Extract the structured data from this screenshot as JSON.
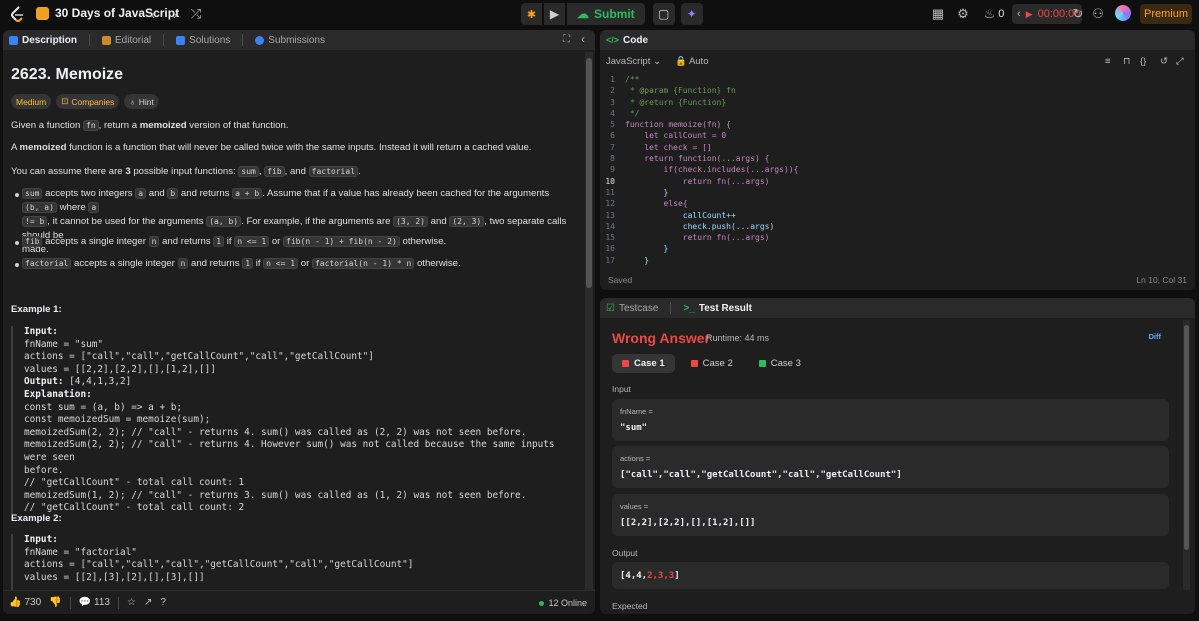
{
  "topbar": {
    "list_title": "30 Days of JavaScript",
    "submit_label": "Submit",
    "streak": "0",
    "timer": "00:00:00",
    "premium_label": "Premium"
  },
  "left": {
    "tabs": [
      "Description",
      "Editorial",
      "Solutions",
      "Submissions"
    ],
    "title": "2623. Memoize",
    "pills": [
      "Medium",
      "Companies",
      "Hint"
    ],
    "p1_a": "Given a function ",
    "p1_code": "fn",
    "p1_b": ", return a ",
    "p1_bold": "memoized",
    "p1_c": " version of that function.",
    "p2_a": "A ",
    "p2_bold": "memoized",
    "p2_b": " function is a function that will never be called twice with the same inputs. Instead it will return a cached value.",
    "p3_a": "You can assume there are ",
    "p3_bold": "3",
    "p3_b": " possible input functions: ",
    "p3_c1": "sum",
    "p3_c2": "fib",
    "p3_c3": "factorial",
    "p3_and": ", and ",
    "bullet1": {
      "c1": "sum",
      "t1": " accepts two integers ",
      "c2": "a",
      "t2": " and ",
      "c3": "b",
      "t3": " and returns ",
      "c4": "a + b",
      "t4": ". Assume that if a value has already been cached for the arguments ",
      "c5": "(b, a)",
      "t5": " where ",
      "c6": "a",
      "c7": "!= b",
      "t6": ", it cannot be used for the arguments ",
      "c8": "(a, b)",
      "t7": ". For example, if the arguments are ",
      "c9": "(3, 2)",
      "t8": " and ",
      "c10": "(2, 3)",
      "t9": ", two separate calls should be",
      "t10": "made."
    },
    "bullet2": {
      "c1": "fib",
      "t1": " accepts a single integer ",
      "c2": "n",
      "t2": " and returns ",
      "c3": "1",
      "t3": " if ",
      "c4": "n <= 1",
      "t4": " or ",
      "c5": "fib(n - 1) + fib(n - 2)",
      "t5": " otherwise."
    },
    "bullet3": {
      "c1": "factorial",
      "t1": " accepts a single integer ",
      "c2": "n",
      "t2": " and returns ",
      "c3": "1",
      "t3": " if ",
      "c4": "n <= 1",
      "t4": " or ",
      "c5": "factorial(n - 1) * n",
      "t5": " otherwise."
    },
    "example1_title": "Example 1:",
    "example1_lines": [
      {
        "b": "Input:",
        "t": ""
      },
      {
        "b": "",
        "t": "fnName = \"sum\""
      },
      {
        "b": "",
        "t": "actions = [\"call\",\"call\",\"getCallCount\",\"call\",\"getCallCount\"]"
      },
      {
        "b": "",
        "t": "values = [[2,2],[2,2],[],[1,2],[]]"
      },
      {
        "b": "Output:",
        "t": " [4,4,1,3,2]"
      },
      {
        "b": "Explanation:",
        "t": ""
      },
      {
        "b": "",
        "t": "const sum = (a, b) => a + b;"
      },
      {
        "b": "",
        "t": "const memoizedSum = memoize(sum);"
      },
      {
        "b": "",
        "t": "memoizedSum(2, 2); // \"call\" - returns 4. sum() was called as (2, 2) was not seen before."
      },
      {
        "b": "",
        "t": "memoizedSum(2, 2); // \"call\" - returns 4. However sum() was not called because the same inputs were seen"
      },
      {
        "b": "",
        "t": "before."
      },
      {
        "b": "",
        "t": "// \"getCallCount\" - total call count: 1"
      },
      {
        "b": "",
        "t": "memoizedSum(1, 2); // \"call\" - returns 3. sum() was called as (1, 2) was not seen before."
      },
      {
        "b": "",
        "t": "// \"getCallCount\" - total call count: 2"
      }
    ],
    "example2_title": "Example 2:",
    "example2_lines": [
      {
        "b": "Input:",
        "t": ""
      },
      {
        "b": "",
        "t": "fnName = \"factorial\""
      },
      {
        "b": "",
        "t": "actions = [\"call\",\"call\",\"call\",\"getCallCount\",\"call\",\"getCallCount\"]"
      },
      {
        "b": "",
        "t": "values = [[2],[3],[2],[],[3],[]]"
      }
    ],
    "likes": "730",
    "comments": "113",
    "online": "12 Online"
  },
  "code": {
    "title": "Code",
    "language": "JavaScript",
    "mode": "Auto",
    "lines": [
      "/**",
      " * @param {Function} fn",
      " * @return {Function}",
      " */",
      "function memoize(fn) {",
      "    let callCount = 0",
      "    let check = []",
      "    return function(...args) {",
      "        if(check.includes(...args)){",
      "            return fn(...args)",
      "        }",
      "        else{",
      "            callCount++",
      "            check.push(...args)",
      "            return fn(...args)",
      "        }",
      "    }"
    ],
    "current_line": 10,
    "saved": "Saved",
    "cursor": "Ln 10, Col 31"
  },
  "result": {
    "tabs": [
      "Testcase",
      "Test Result"
    ],
    "status": "Wrong Answer",
    "runtime": "Runtime: 44 ms",
    "diff": "Diff",
    "cases": [
      "Case 1",
      "Case 2",
      "Case 3"
    ],
    "input_label": "Input",
    "inputs": [
      {
        "name": "fnName =",
        "value": "\"sum\""
      },
      {
        "name": "actions =",
        "value": "[\"call\",\"call\",\"getCallCount\",\"call\",\"getCallCount\"]"
      },
      {
        "name": "values =",
        "value": "[[2,2],[2,2],[],[1,2],[]]"
      }
    ],
    "output_label": "Output",
    "output_ok": "[4,4,",
    "output_bad": "2,3,3",
    "output_end": "]",
    "expected_label": "Expected"
  },
  "colors": {
    "accent": "#ffa116",
    "success": "#2cbb5d",
    "error": "#ef4743",
    "panel": "#1e1e1e"
  }
}
